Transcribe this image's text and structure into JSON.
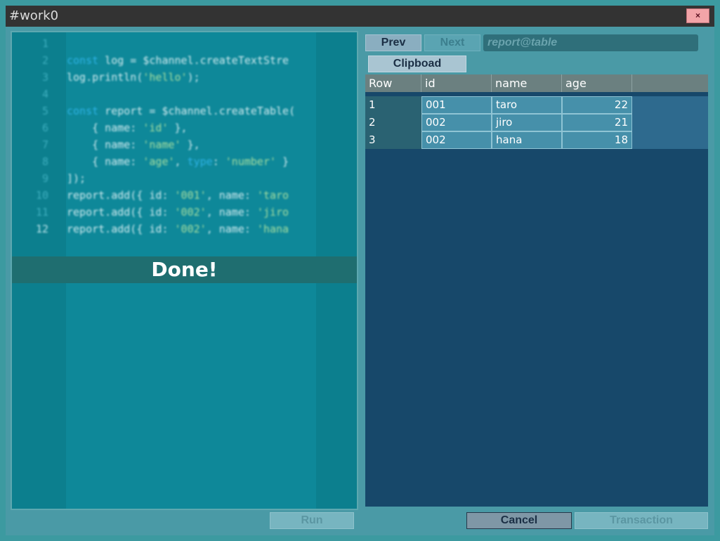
{
  "window": {
    "title": "#work0",
    "close_label": "×"
  },
  "editor": {
    "lines": [
      {
        "n": "1",
        "parts": []
      },
      {
        "n": "2",
        "parts": [
          {
            "t": "const",
            "c": "kw"
          },
          {
            "t": " log = $channel.createTextStre",
            "c": ""
          }
        ]
      },
      {
        "n": "3",
        "parts": [
          {
            "t": "log.println(",
            "c": ""
          },
          {
            "t": "'hello'",
            "c": "str"
          },
          {
            "t": ");",
            "c": ""
          }
        ]
      },
      {
        "n": "4",
        "parts": []
      },
      {
        "n": "5",
        "parts": [
          {
            "t": "const",
            "c": "kw"
          },
          {
            "t": " report = $channel.createTable(",
            "c": ""
          }
        ]
      },
      {
        "n": "6",
        "parts": [
          {
            "t": "    { name: ",
            "c": ""
          },
          {
            "t": "'id'",
            "c": "str"
          },
          {
            "t": " },",
            "c": ""
          }
        ]
      },
      {
        "n": "7",
        "parts": [
          {
            "t": "    { name: ",
            "c": ""
          },
          {
            "t": "'name'",
            "c": "str"
          },
          {
            "t": " },",
            "c": ""
          }
        ]
      },
      {
        "n": "8",
        "parts": [
          {
            "t": "    { name: ",
            "c": ""
          },
          {
            "t": "'age'",
            "c": "str"
          },
          {
            "t": ", ",
            "c": ""
          },
          {
            "t": "type",
            "c": "kw"
          },
          {
            "t": ": ",
            "c": ""
          },
          {
            "t": "'number'",
            "c": "str"
          },
          {
            "t": " }",
            "c": ""
          }
        ]
      },
      {
        "n": "9",
        "parts": [
          {
            "t": "]);",
            "c": ""
          }
        ]
      },
      {
        "n": "10",
        "parts": [
          {
            "t": "report.add({ id: ",
            "c": ""
          },
          {
            "t": "'001'",
            "c": "str"
          },
          {
            "t": ", name: ",
            "c": ""
          },
          {
            "t": "'taro",
            "c": "str"
          }
        ]
      },
      {
        "n": "11",
        "parts": [
          {
            "t": "report.add({ id: ",
            "c": ""
          },
          {
            "t": "'002'",
            "c": "str"
          },
          {
            "t": ", name: ",
            "c": ""
          },
          {
            "t": "'jiro",
            "c": "str"
          }
        ]
      },
      {
        "n": "12",
        "parts": [
          {
            "t": "report.add({ id: ",
            "c": ""
          },
          {
            "t": "'002'",
            "c": "str"
          },
          {
            "t": ", name: ",
            "c": ""
          },
          {
            "t": "'hana",
            "c": "str"
          }
        ]
      }
    ],
    "active_line": "12",
    "status_overlay": "Done!",
    "run_label": "Run"
  },
  "report": {
    "prev_label": "Prev",
    "next_label": "Next",
    "current_name": "report@table",
    "clipboard_label": "Clipboad",
    "columns": [
      "Row",
      "id",
      "name",
      "age"
    ],
    "rows": [
      {
        "row": "1",
        "id": "001",
        "name": "taro",
        "age": "22"
      },
      {
        "row": "2",
        "id": "002",
        "name": "jiro",
        "age": "21"
      },
      {
        "row": "3",
        "id": "002",
        "name": "hana",
        "age": "18"
      }
    ],
    "cancel_label": "Cancel",
    "transaction_label": "Transaction"
  }
}
